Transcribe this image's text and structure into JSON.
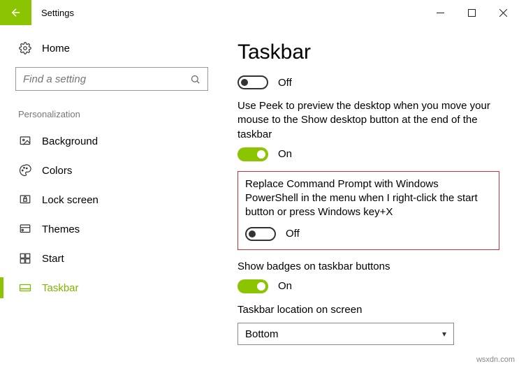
{
  "window": {
    "title": "Settings"
  },
  "sidebar": {
    "home": "Home",
    "search_placeholder": "Find a setting",
    "section": "Personalization",
    "items": [
      {
        "label": "Background"
      },
      {
        "label": "Colors"
      },
      {
        "label": "Lock screen"
      },
      {
        "label": "Themes"
      },
      {
        "label": "Start"
      },
      {
        "label": "Taskbar"
      }
    ]
  },
  "main": {
    "heading": "Taskbar",
    "settings": {
      "s0": {
        "state": "Off"
      },
      "peek": {
        "desc": "Use Peek to preview the desktop when you move your mouse to the Show desktop button at the end of the taskbar",
        "state": "On"
      },
      "powershell": {
        "desc": "Replace Command Prompt with Windows PowerShell in the menu when I right-click the start button or press Windows key+X",
        "state": "Off"
      },
      "badges": {
        "desc": "Show badges on taskbar buttons",
        "state": "On"
      },
      "location": {
        "desc": "Taskbar location on screen",
        "value": "Bottom"
      }
    }
  },
  "watermark": "wsxdn.com"
}
